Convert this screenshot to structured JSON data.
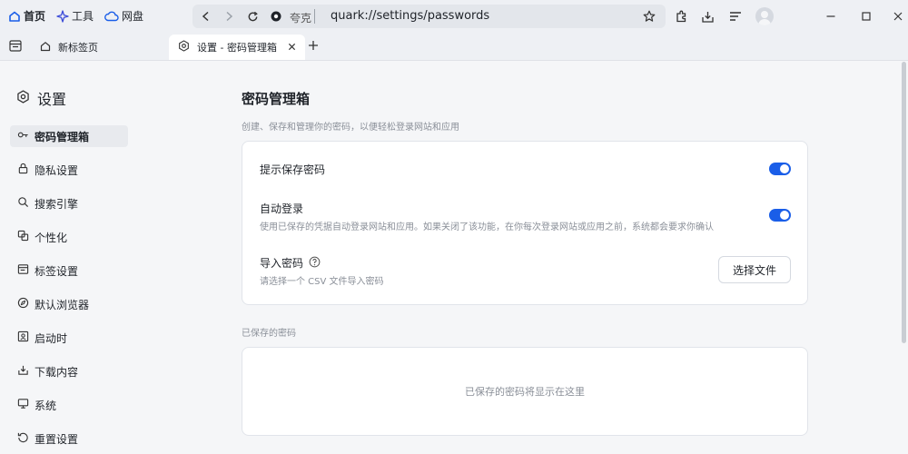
{
  "toolbar": {
    "home_label": "首页",
    "tools_label": "工具",
    "cloud_label": "网盘"
  },
  "address_bar": {
    "engine_label": "夸克",
    "url": "quark://settings/passwords"
  },
  "tabs": [
    {
      "label": "新标签页"
    },
    {
      "label": "设置 - 密码管理箱"
    }
  ],
  "sidebar": {
    "title": "设置",
    "items": [
      {
        "label": "密码管理箱",
        "icon": "key-icon",
        "active": true
      },
      {
        "label": "隐私设置",
        "icon": "lock-icon",
        "active": false
      },
      {
        "label": "搜索引擎",
        "icon": "search-icon",
        "active": false
      },
      {
        "label": "个性化",
        "icon": "personalize-icon",
        "active": false
      },
      {
        "label": "标签设置",
        "icon": "tab-icon",
        "active": false
      },
      {
        "label": "默认浏览器",
        "icon": "compass-icon",
        "active": false
      },
      {
        "label": "启动时",
        "icon": "startup-icon",
        "active": false
      },
      {
        "label": "下载内容",
        "icon": "download-icon",
        "active": false
      },
      {
        "label": "系统",
        "icon": "monitor-icon",
        "active": false
      },
      {
        "label": "重置设置",
        "icon": "reset-icon",
        "active": false
      }
    ]
  },
  "main": {
    "title": "密码管理箱",
    "description": "创建、保存和管理你的密码，以便轻松登录网站和应用",
    "offer_save": {
      "label": "提示保存密码",
      "enabled": true
    },
    "auto_signin": {
      "label": "自动登录",
      "description": "使用已保存的凭据自动登录网站和应用。如果关闭了该功能，在你每次登录网站或应用之前，系统都会要求你确认",
      "enabled": true
    },
    "import": {
      "label": "导入密码",
      "description": "请选择一个 CSV 文件导入密码",
      "button_label": "选择文件"
    },
    "saved_section_label": "已保存的密码",
    "saved_empty_text": "已保存的密码将显示在这里"
  },
  "colors": {
    "accent": "#1a5ee8",
    "background": "#f5f6f8",
    "card": "#ffffff"
  }
}
